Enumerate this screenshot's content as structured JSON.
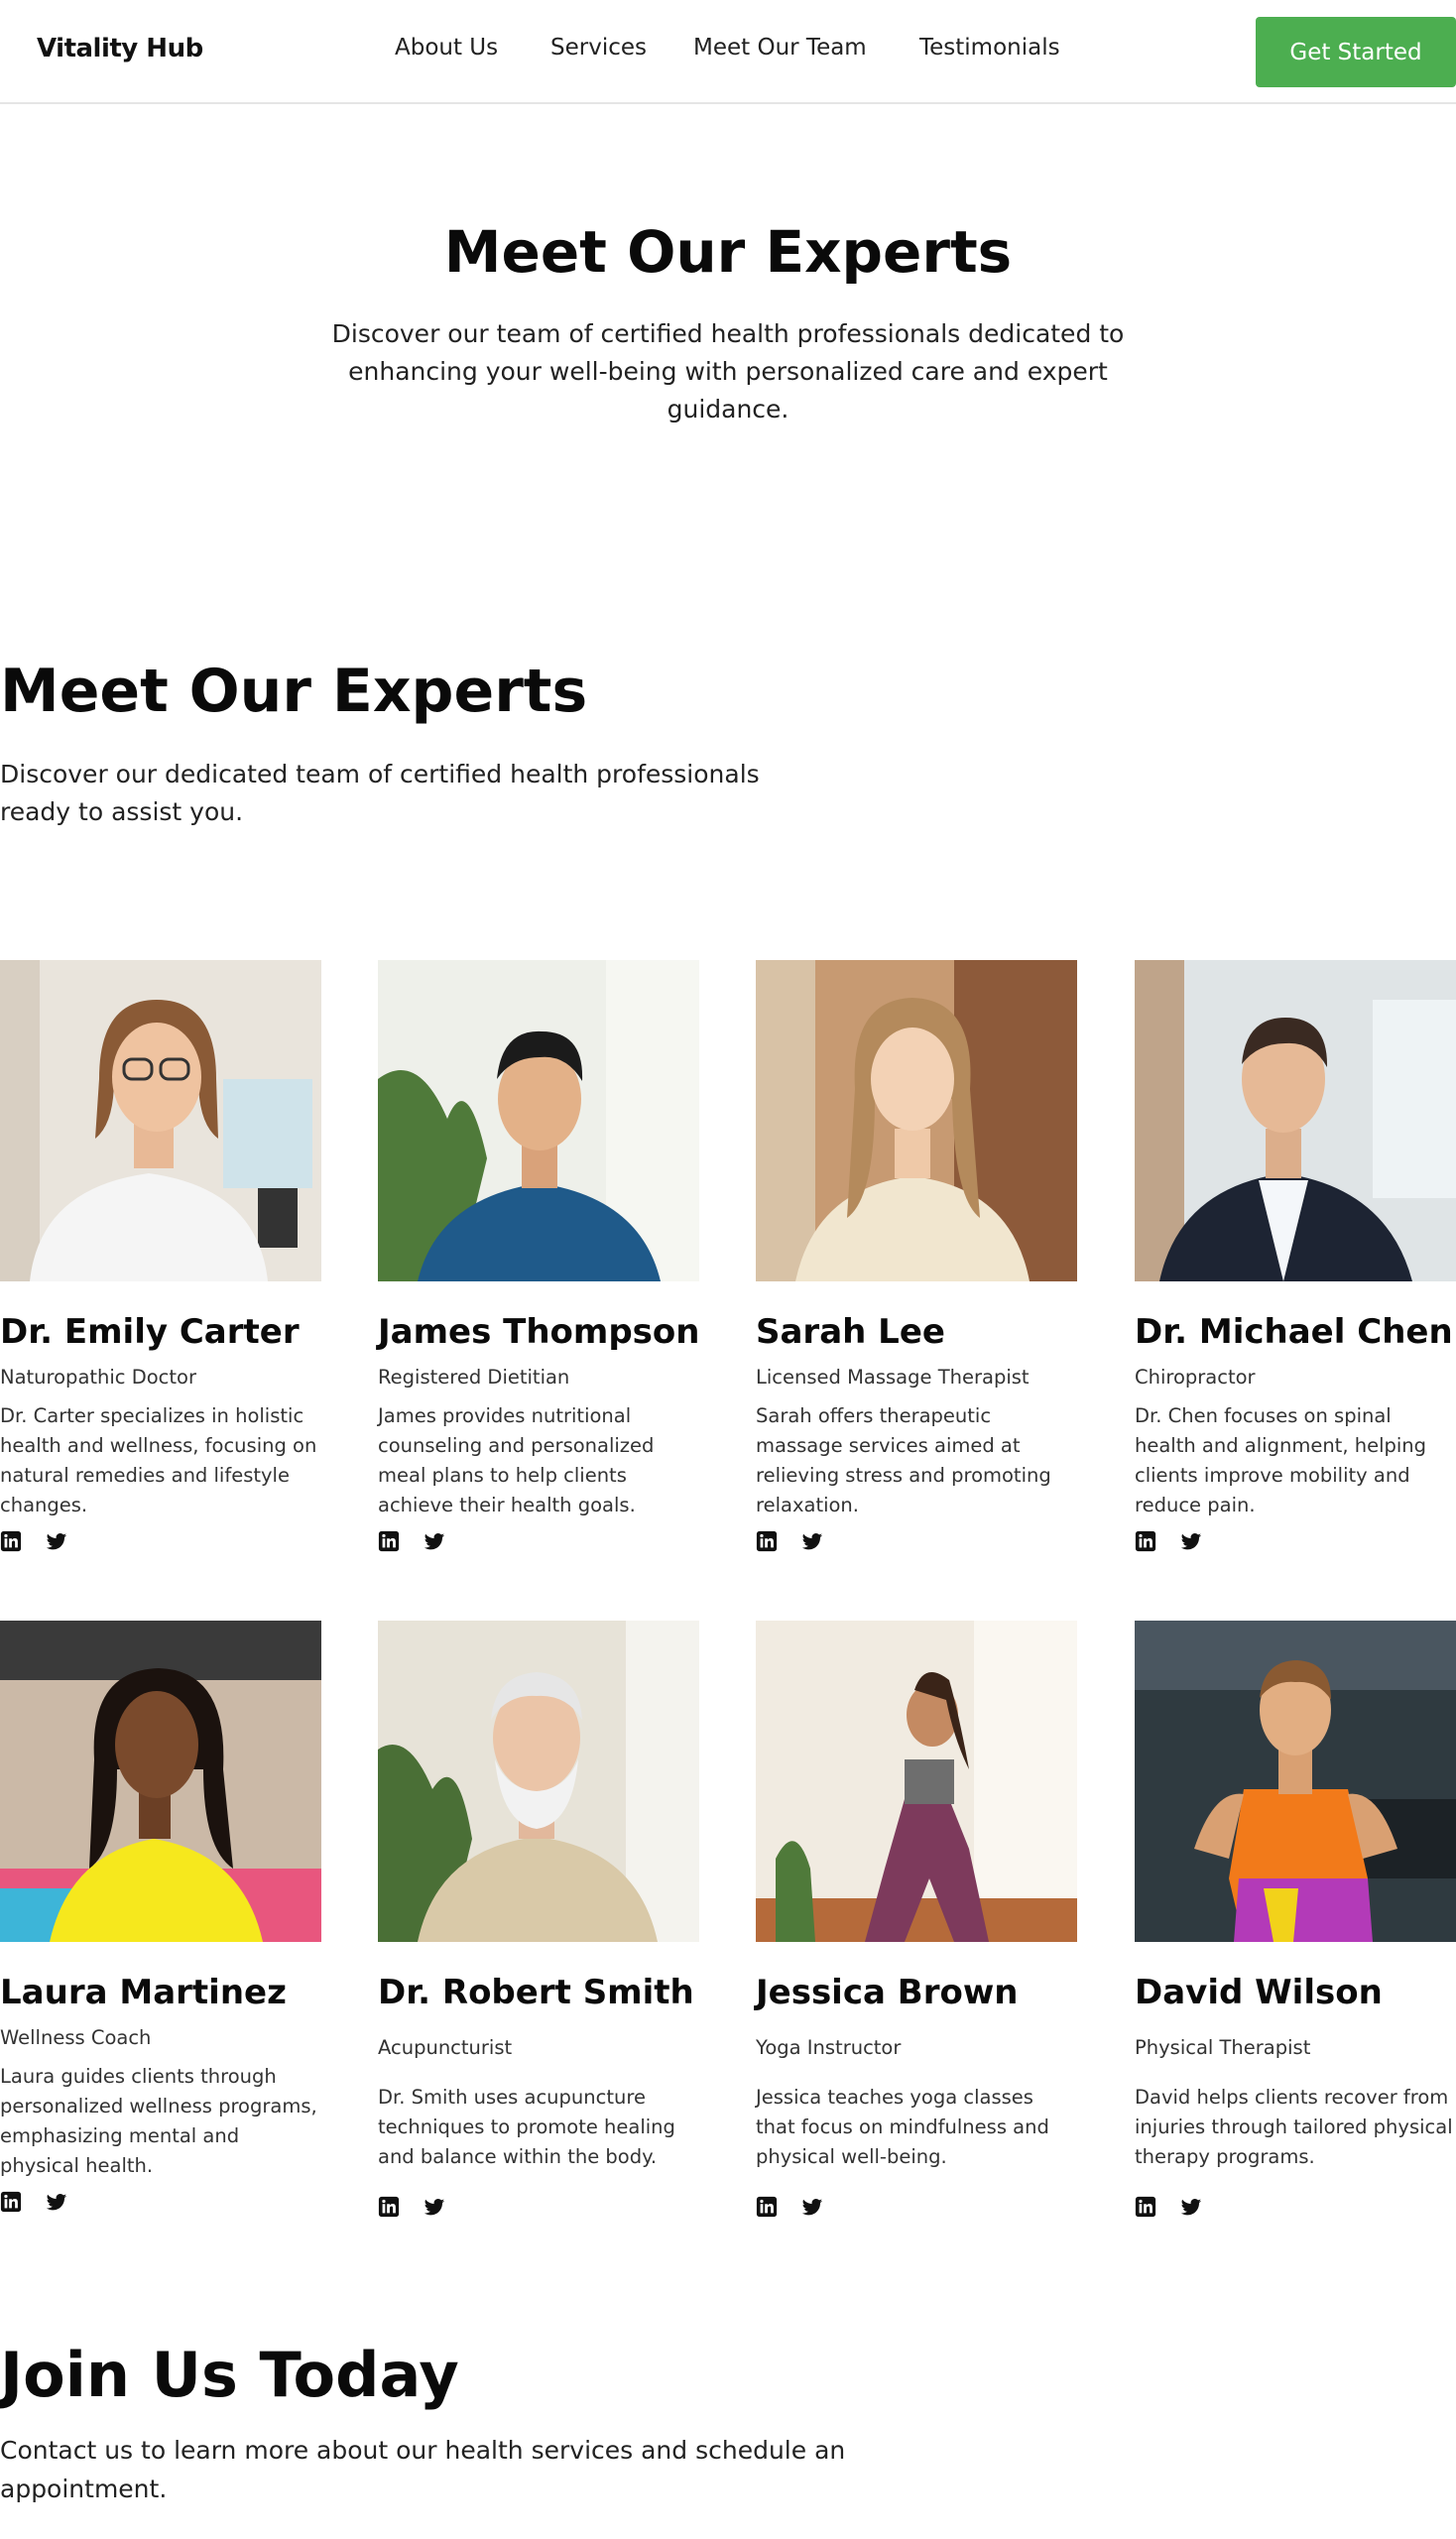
{
  "header": {
    "logo": "Vitality Hub",
    "nav": [
      "About Us",
      "Services",
      "Meet Our Team",
      "Testimonials"
    ],
    "cta": "Get Started",
    "accent": "#4cae50"
  },
  "hero": {
    "title": "Meet Our Experts",
    "subtitle": "Discover our team of certified health professionals dedicated to enhancing your well-being with personalized care and expert guidance."
  },
  "experts": {
    "title": "Meet Our Experts",
    "subtitle": "Discover our dedicated team of certified health professionals ready to assist you.",
    "members": [
      {
        "name": "Dr. Emily Carter",
        "role": "Naturopathic Doctor",
        "bio": "Dr. Carter specializes in holistic health and wellness, focusing on natural remedies and lifestyle changes."
      },
      {
        "name": "James Thompson",
        "role": "Registered Dietitian",
        "bio": "James provides nutritional counseling and personalized meal plans to help clients achieve their health goals."
      },
      {
        "name": "Sarah Lee",
        "role": "Licensed Massage Therapist",
        "bio": "Sarah offers therapeutic massage services aimed at relieving stress and promoting relaxation."
      },
      {
        "name": "Dr. Michael Chen",
        "role": "Chiropractor",
        "bio": "Dr. Chen focuses on spinal health and alignment, helping clients improve mobility and reduce pain."
      },
      {
        "name": "Laura Martinez",
        "role": "Wellness Coach",
        "bio": "Laura guides clients through personalized wellness programs, emphasizing mental and physical health."
      },
      {
        "name": "Dr. Robert Smith",
        "role": "Acupuncturist",
        "bio": "Dr. Smith uses acupuncture techniques to promote healing and balance within the body."
      },
      {
        "name": "Jessica Brown",
        "role": "Yoga Instructor",
        "bio": "Jessica teaches yoga classes that focus on mindfulness and physical well-being."
      },
      {
        "name": "David Wilson",
        "role": "Physical Therapist",
        "bio": "David helps clients recover from injuries through tailored physical therapy programs."
      }
    ],
    "social_icons": [
      "linkedin-icon",
      "twitter-icon"
    ]
  },
  "join": {
    "title": "Join Us Today",
    "subtitle": "Contact us to learn more about our health services and schedule an appointment."
  }
}
